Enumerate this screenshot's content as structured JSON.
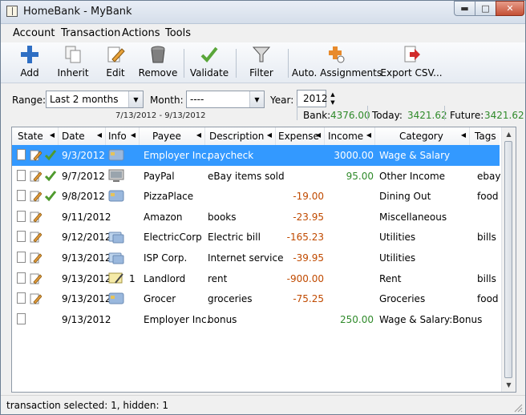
{
  "window": {
    "title": "HomeBank - MyBank"
  },
  "menu": [
    "Account",
    "Transaction",
    "Actions",
    "Tools"
  ],
  "toolbar": {
    "add": "Add",
    "inherit": "Inherit",
    "edit": "Edit",
    "remove": "Remove",
    "validate": "Validate",
    "filter": "Filter",
    "auto_assign": "Auto. Assignments",
    "export_csv": "Export CSV..."
  },
  "filter": {
    "range_label": "Range:",
    "range_value": "Last 2 months",
    "month_label": "Month:",
    "month_value": "----",
    "year_label": "Year:",
    "year_value": "2012",
    "date_range": "7/13/2012 - 9/13/2012"
  },
  "totals": {
    "bank_label": "Bank:",
    "bank_value": "4376.00",
    "today_label": "Today:",
    "today_value": "3421.62",
    "future_label": "Future:",
    "future_value": "3421.62"
  },
  "columns": [
    "State",
    "Date",
    "Info",
    "Payee",
    "Description",
    "Expense",
    "Income",
    "Category",
    "Tags"
  ],
  "rows": [
    {
      "date": "9/3/2012",
      "payee": "Employer Inc.",
      "desc": "paycheck",
      "expense": "",
      "income": "3000.00",
      "category": "Wage & Salary",
      "tags": "",
      "edited": true,
      "validated": true,
      "info": "card",
      "info_num": "",
      "selected": true
    },
    {
      "date": "9/7/2012",
      "payee": "PayPal",
      "desc": "eBay items sold",
      "expense": "",
      "income": "95.00",
      "category": "Other Income",
      "tags": "ebay",
      "edited": true,
      "validated": true,
      "info": "pc",
      "info_num": "",
      "selected": false
    },
    {
      "date": "9/8/2012",
      "payee": "PizzaPlace",
      "desc": "",
      "expense": "-19.00",
      "income": "",
      "category": "Dining Out",
      "tags": "food",
      "edited": true,
      "validated": true,
      "info": "card",
      "info_num": "",
      "selected": false
    },
    {
      "date": "9/11/2012",
      "payee": "Amazon",
      "desc": "books",
      "expense": "-23.95",
      "income": "",
      "category": "Miscellaneous",
      "tags": "",
      "edited": true,
      "validated": false,
      "info": "",
      "info_num": "",
      "selected": false
    },
    {
      "date": "9/12/2012",
      "payee": "ElectricCorp",
      "desc": "Electric bill",
      "expense": "-165.23",
      "income": "",
      "category": "Utilities",
      "tags": "bills",
      "edited": true,
      "validated": false,
      "info": "transfer",
      "info_num": "",
      "selected": false
    },
    {
      "date": "9/13/2012",
      "payee": "ISP Corp.",
      "desc": "Internet service",
      "expense": "-39.95",
      "income": "",
      "category": "Utilities",
      "tags": "",
      "edited": true,
      "validated": false,
      "info": "transfer",
      "info_num": "",
      "selected": false
    },
    {
      "date": "9/13/2012",
      "payee": "Landlord",
      "desc": "rent",
      "expense": "-900.00",
      "income": "",
      "category": "Rent",
      "tags": "bills",
      "edited": true,
      "validated": false,
      "info": "check",
      "info_num": "1",
      "selected": false
    },
    {
      "date": "9/13/2012",
      "payee": "Grocer",
      "desc": "groceries",
      "expense": "-75.25",
      "income": "",
      "category": "Groceries",
      "tags": "food",
      "edited": true,
      "validated": false,
      "info": "card",
      "info_num": "",
      "selected": false
    },
    {
      "date": "9/13/2012",
      "payee": "Employer Inc.",
      "desc": "bonus",
      "expense": "",
      "income": "250.00",
      "category": "Wage & Salary:Bonus",
      "tags": "",
      "edited": false,
      "validated": false,
      "info": "",
      "info_num": "",
      "selected": false
    }
  ],
  "status": "transaction selected: 1, hidden: 1",
  "colors": {
    "selection": "#3399ff",
    "income": "#2f8a2a",
    "expense": "#c04a00"
  }
}
